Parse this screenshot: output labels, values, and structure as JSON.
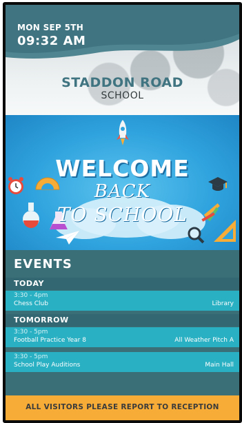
{
  "header": {
    "date": "MON SEP 5TH",
    "time": "09:32 AM",
    "school_name": "STADDON ROAD",
    "school_sub": "SCHOOL"
  },
  "banner": {
    "line1": "WELCOME",
    "line2": "BACK",
    "line3": "TO SCHOOL"
  },
  "events": {
    "title": "EVENTS",
    "days": [
      {
        "label": "TODAY",
        "items": [
          {
            "time": "3:30 - 4pm",
            "name": "Chess Club",
            "location": "Library"
          }
        ]
      },
      {
        "label": "TOMORROW",
        "items": [
          {
            "time": "3:30 - 5pm",
            "name": "Football Practice Year 8",
            "location": "All Weather Pitch A"
          },
          {
            "time": "3:30 - 5pm",
            "name": "School Play Auditions",
            "location": "Main Hall"
          }
        ]
      }
    ]
  },
  "notice": {
    "text": "ALL VISITORS PLEASE REPORT TO RECEPTION"
  },
  "colors": {
    "teal_dark": "#3b6f78",
    "teal_row": "#2ab0c3",
    "accent_orange": "#f6ac37",
    "title_teal": "#3f7480",
    "banner_blue": "#2fa3de"
  }
}
